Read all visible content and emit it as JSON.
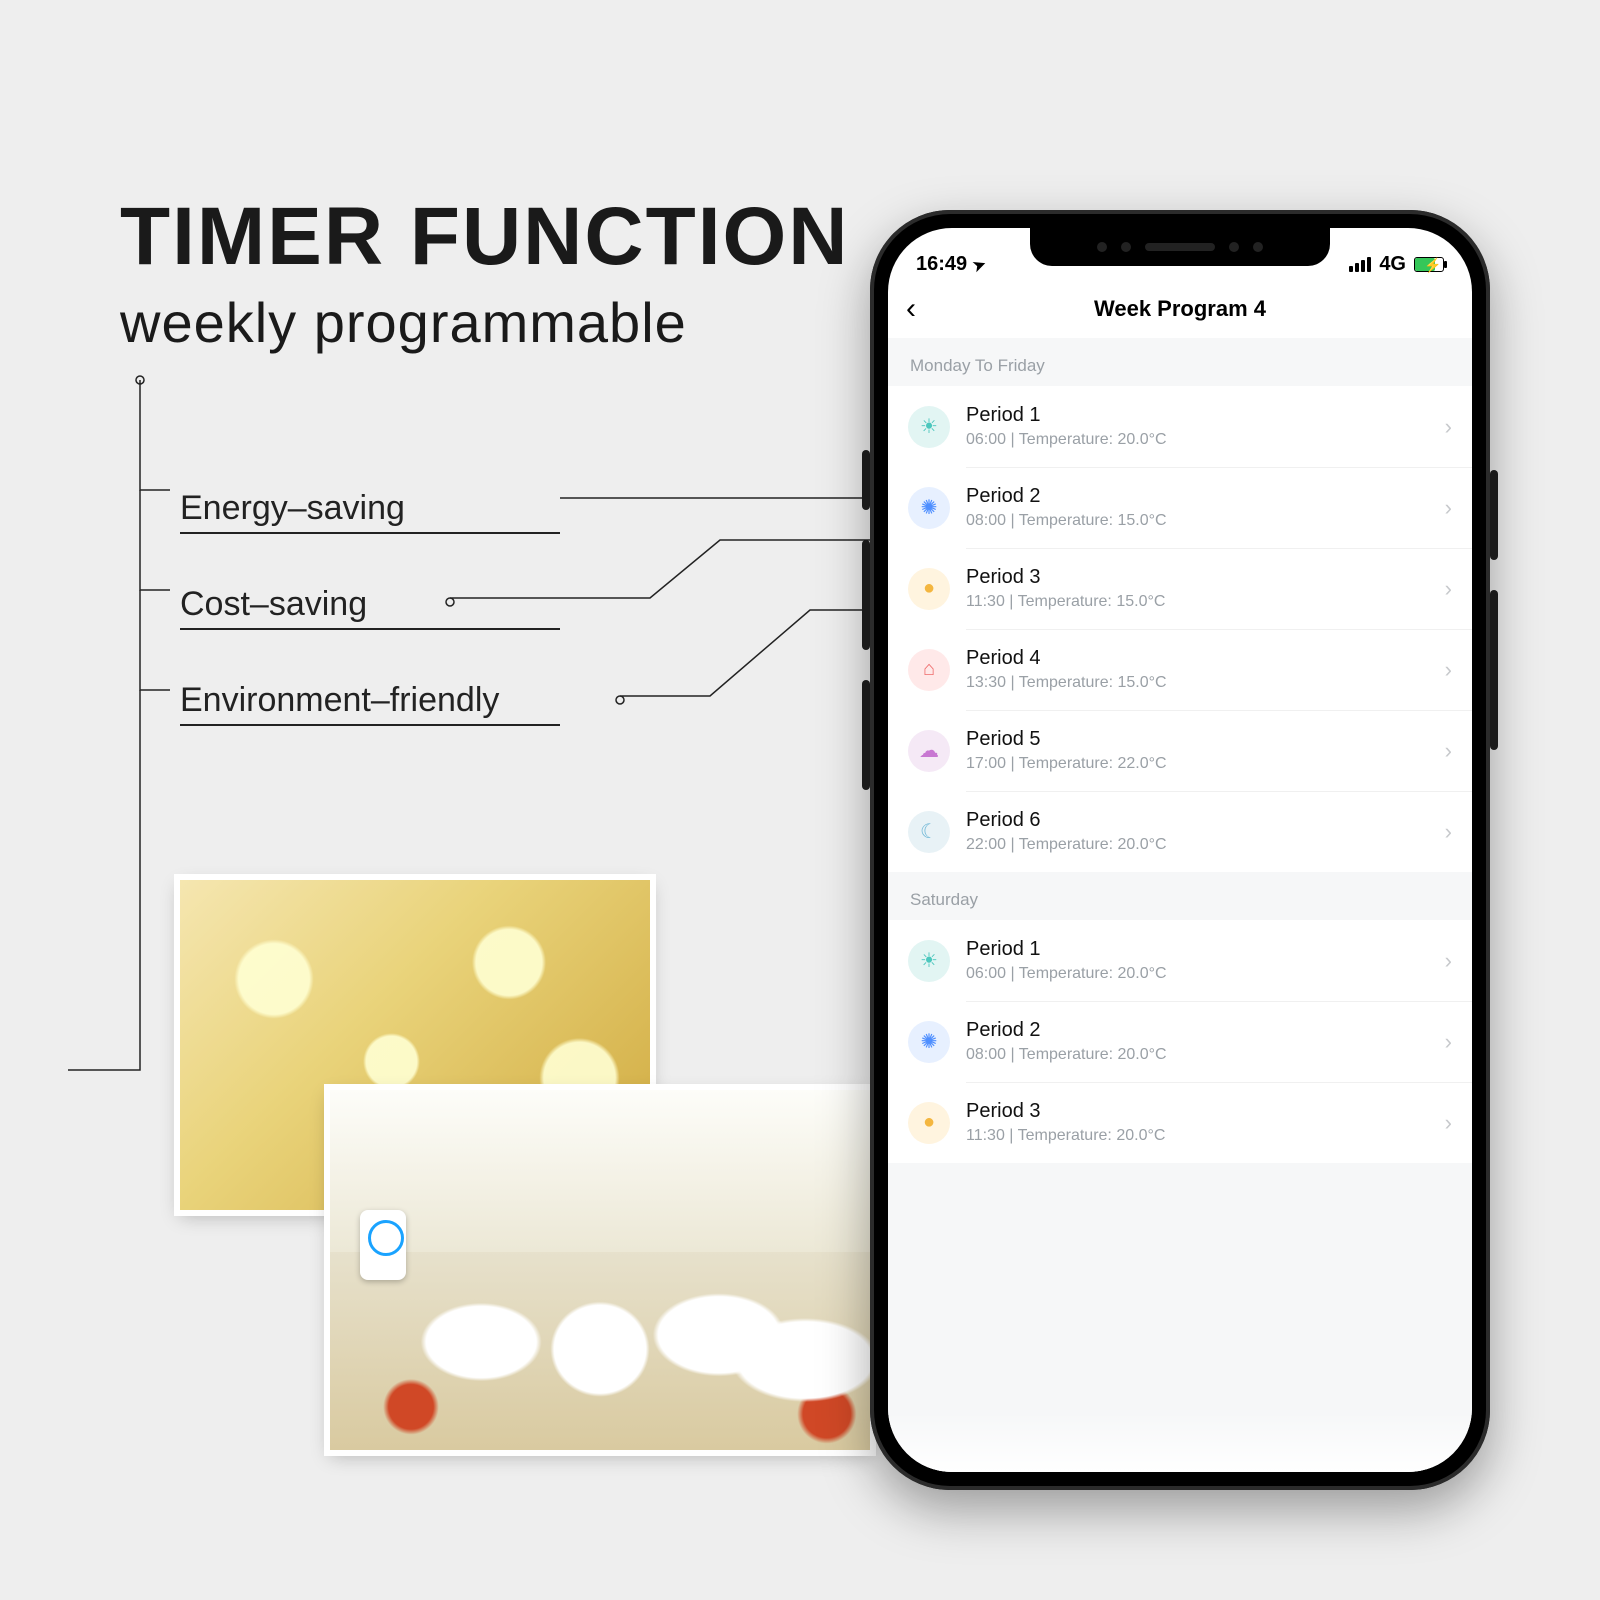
{
  "headline": {
    "title": "TIMER FUNCTION",
    "subtitle": "weekly programmable"
  },
  "features": [
    "Energy–saving",
    "Cost–saving",
    "Environment–friendly"
  ],
  "status": {
    "time": "16:49",
    "network": "4G"
  },
  "page": {
    "title": "Week Program 4"
  },
  "sections": [
    {
      "label": "Monday To Friday",
      "periods": [
        {
          "icon": "sunrise",
          "name": "Period 1",
          "time": "06:00",
          "temp": "Temperature: 20.0°C"
        },
        {
          "icon": "sun",
          "name": "Period 2",
          "time": "08:00",
          "temp": "Temperature: 15.0°C"
        },
        {
          "icon": "person",
          "name": "Period 3",
          "time": "11:30",
          "temp": "Temperature: 15.0°C"
        },
        {
          "icon": "home",
          "name": "Period 4",
          "time": "13:30",
          "temp": "Temperature: 15.0°C"
        },
        {
          "icon": "sunset",
          "name": "Period 5",
          "time": "17:00",
          "temp": "Temperature: 22.0°C"
        },
        {
          "icon": "moon",
          "name": "Period 6",
          "time": "22:00",
          "temp": "Temperature: 20.0°C"
        }
      ]
    },
    {
      "label": "Saturday",
      "periods": [
        {
          "icon": "sunrise",
          "name": "Period 1",
          "time": "06:00",
          "temp": "Temperature: 20.0°C"
        },
        {
          "icon": "sun",
          "name": "Period 2",
          "time": "08:00",
          "temp": "Temperature: 20.0°C"
        },
        {
          "icon": "person",
          "name": "Period 3",
          "time": "11:30",
          "temp": "Temperature: 20.0°C"
        }
      ]
    }
  ],
  "glyphs": {
    "sunrise": "☀",
    "sun": "✺",
    "person": "●",
    "home": "⌂",
    "sunset": "☁",
    "moon": "☾",
    "locarrow": "➤",
    "chevron": "›",
    "back": "‹",
    "bolt": "⚡"
  }
}
